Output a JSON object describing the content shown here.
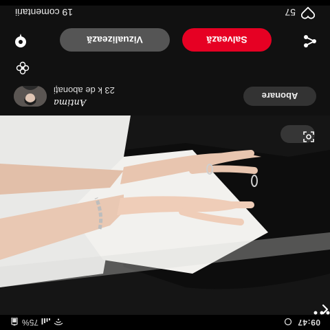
{
  "status_bar": {
    "time": "09:47",
    "battery": "75%"
  },
  "author": {
    "name": "Antima",
    "subscribers": "23 k de abonați",
    "follow_label": "Abonare"
  },
  "actions": {
    "save_label": "Salvează",
    "view_label": "Vizualizează"
  },
  "reactions": {
    "likes": "57",
    "comments": "19 comentarii"
  },
  "icons": {
    "back": "chevron-left-icon",
    "more": "more-dots-icon",
    "lens": "visual-search-icon",
    "share": "share-icon",
    "pin": "pin-icon",
    "like": "heart-icon",
    "flower": "flower-icon"
  },
  "colors": {
    "accent": "#e60023",
    "background": "#111111",
    "follow_button": "#333333"
  }
}
